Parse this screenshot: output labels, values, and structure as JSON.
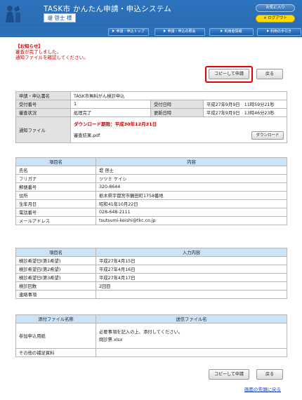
{
  "header": {
    "system_title": "TASK市 かんたん申請・申込システム",
    "user_name": "堤 啓士 様",
    "favorites_label": "お気に入り",
    "logout_label": "× ログアウト"
  },
  "nav": {
    "items": [
      "申請・申込トップ",
      "申請・申込の照会",
      "利用者情報",
      "利用の手引き"
    ]
  },
  "notice": {
    "title": "【お知らせ】",
    "lines": [
      "審査が完了しました。",
      "通知ファイルを確認してください。"
    ]
  },
  "actions": {
    "copy_label": "コピーして申請",
    "back_label": "戻る"
  },
  "application": {
    "name_label": "申請・申込書名",
    "name_value": "TASK市無料がん検診申込",
    "receipt_no_label": "受付番号",
    "receipt_no_value": "1",
    "receipt_datetime_label": "受付日時",
    "receipt_datetime_value": "平成27年9月9日　11時59分21秒",
    "status_label": "審査状況",
    "status_value": "処理完了",
    "updated_label": "更新日時",
    "updated_value": "平成27年9月9日　13時46分23秒",
    "notice_file_label": "通知ファイル",
    "download_limit": "ダウンロード期限：平成30年12月31日",
    "file_name": "審査結果.pdf",
    "download_label": "ダウンロード"
  },
  "profile": {
    "col_item": "項目名",
    "col_content": "内容",
    "rows": [
      {
        "label": "氏名",
        "value": "堤 啓士"
      },
      {
        "label": "フリガナ",
        "value": "ツツミ ケイシ"
      },
      {
        "label": "郵便番号",
        "value": "320-8644"
      },
      {
        "label": "住所",
        "value": "栃木県宇都宮市鶴田町1758番地"
      },
      {
        "label": "生年月日",
        "value": "昭和41年10月22日"
      },
      {
        "label": "電話番号",
        "value": "028-648-2111"
      },
      {
        "label": "メールアドレス",
        "value": "tsutsumi-keishi@tkc.co.jp"
      }
    ]
  },
  "inputs": {
    "col_item": "項目名",
    "col_content": "入力内容",
    "rows": [
      {
        "label": "検診希望日(第1希望)",
        "value": "平成27年4月15日"
      },
      {
        "label": "検診希望日(第2希望)",
        "value": "平成27年4月16日"
      },
      {
        "label": "検診希望日(第3希望)",
        "value": "平成27年4月17日"
      },
      {
        "label": "検診回数",
        "value": "2回目"
      },
      {
        "label": "連絡事項",
        "value": ""
      }
    ]
  },
  "attachments": {
    "col_name": "添付ファイル名称",
    "col_file": "送信ファイル名",
    "rows": [
      {
        "label": "参加申込用紙",
        "note": "必要事項を記入の上、添付してください。",
        "file": "問診票.xlsx"
      },
      {
        "label": "その他の補足資料",
        "note": "",
        "file": ""
      }
    ]
  },
  "footer": {
    "back_to_top": "画面の先頭に戻る"
  }
}
